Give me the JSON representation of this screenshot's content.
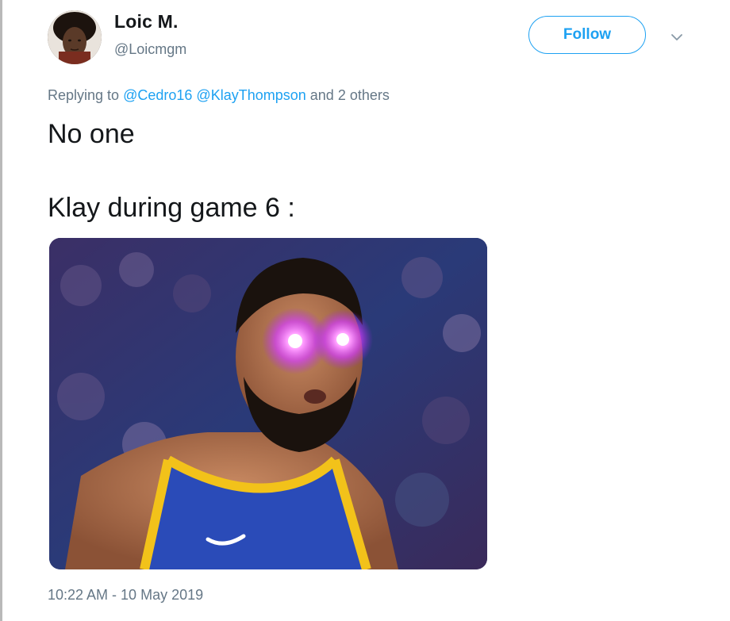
{
  "tweet": {
    "author": {
      "name": "Loic M.",
      "handle": "@Loicmgm"
    },
    "follow_label": "Follow",
    "reply": {
      "prefix": "Replying to",
      "mentions": [
        "@Cedro16",
        "@KlayThompson"
      ],
      "suffix": "and 2 others"
    },
    "text_lines": [
      "No one",
      "Klay during game 6 :"
    ],
    "timestamp": "10:22 AM - 10 May 2019"
  },
  "colors": {
    "accent": "#1da1f2",
    "text": "#14171a",
    "muted": "#657786"
  },
  "icons": {
    "menu": "chevron-down-icon"
  }
}
